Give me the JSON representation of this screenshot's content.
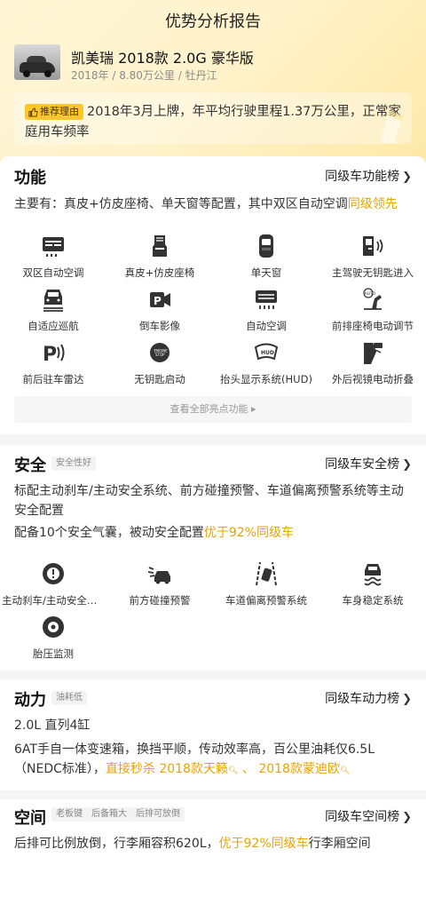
{
  "page": {
    "title": "优势分析报告"
  },
  "car": {
    "name": "凯美瑞 2018款 2.0G 豪华版",
    "meta": "2018年 / 8.80万公里 / 牡丹江"
  },
  "recommend": {
    "badge": "推荐理由",
    "text": "2018年3月上牌，年平均行驶里程1.37万公里，正常家庭用车频率"
  },
  "function": {
    "title": "功能",
    "link": "同级车功能榜",
    "summary_prefix": "主要有：真皮+仿皮座椅、单天窗等配置，其中双区自动空调",
    "summary_highlight": "同级领先",
    "features": [
      {
        "label": "双区自动空调",
        "icon": "dual-zone-ac-icon"
      },
      {
        "label": "真皮+仿皮座椅",
        "icon": "seat-icon"
      },
      {
        "label": "单天窗",
        "icon": "sunroof-icon"
      },
      {
        "label": "主驾驶无钥匙进入",
        "icon": "keyless-entry-icon"
      },
      {
        "label": "自适应巡航",
        "icon": "adaptive-cruise-icon"
      },
      {
        "label": "倒车影像",
        "icon": "reverse-camera-icon"
      },
      {
        "label": "自动空调",
        "icon": "auto-ac-icon"
      },
      {
        "label": "前排座椅电动调节",
        "icon": "power-seat-icon"
      },
      {
        "label": "前后驻车雷达",
        "icon": "parking-radar-icon"
      },
      {
        "label": "无钥匙启动",
        "icon": "keyless-start-icon"
      },
      {
        "label": "抬头显示系统(HUD)",
        "icon": "hud-icon"
      },
      {
        "label": "外后视镜电动折叠",
        "icon": "mirror-fold-icon"
      }
    ],
    "show_all": "查看全部亮点功能 ▸"
  },
  "safety": {
    "title": "安全",
    "tag": "安全性好",
    "link": "同级车安全榜",
    "text1": "标配主动刹车/主动安全系统、前方碰撞预警、车道偏离预警系统等主动安全配置",
    "text2_prefix": "配备10个安全气囊，被动安全配置",
    "text2_highlight": "优于92%同级车",
    "features": [
      {
        "label": "主动刹车/主动安全系统",
        "icon": "brake-warning-icon"
      },
      {
        "label": "前方碰撞预警",
        "icon": "collision-warning-icon"
      },
      {
        "label": "车道偏离预警系统",
        "icon": "lane-departure-icon"
      },
      {
        "label": "车身稳定系统",
        "icon": "stability-control-icon"
      },
      {
        "label": "胎压监测",
        "icon": "tire-pressure-icon"
      }
    ]
  },
  "power": {
    "title": "动力",
    "tag": "油耗低",
    "link": "同级车动力榜",
    "engine": "2.0L 直列4缸",
    "text_prefix": "6AT手自一体变速箱，换挡平顺，传动效率高，百公里油耗仅6.5L（NEDC标准），",
    "text_highlight": "直接秒杀 2018款天籁",
    "sep": " 、 ",
    "text_highlight2": "2018款蒙迪欧"
  },
  "space": {
    "title": "空间",
    "tags": [
      "老板键",
      "后备箱大",
      "后排可放倒"
    ],
    "link": "同级车空间榜",
    "text_prefix": "后排可比例放倒，行李厢容积620L，",
    "text_highlight": "优于92%同级车",
    "text_suffix": "行李厢空间"
  },
  "colors": {
    "accent": "#e8a300",
    "badge": "#ffc72e",
    "hero": "#fff3cc"
  }
}
